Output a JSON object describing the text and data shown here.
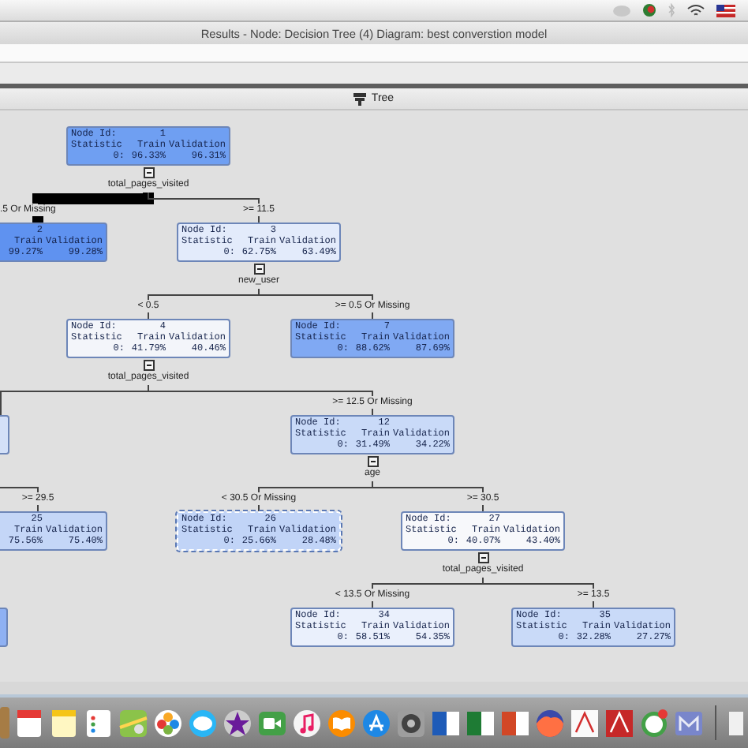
{
  "window": {
    "title": "Results - Node: Decision Tree (4)  Diagram: best converstion model"
  },
  "panel": {
    "title": "Tree"
  },
  "tree": {
    "nodes": [
      {
        "kind": "full",
        "id_label": "Node Id:",
        "id": "1",
        "header": [
          "Statistic",
          "Train",
          "Validation"
        ],
        "row": [
          "0:",
          "96.33%",
          "96.31%"
        ],
        "color": "#6f9ff2",
        "selected": false
      },
      {
        "kind": "cut",
        "id": "2",
        "header": [
          "Train",
          "Validation"
        ],
        "row": [
          "99.27%",
          "99.28%"
        ],
        "color": "#5f92f0",
        "selected": false
      },
      {
        "kind": "full",
        "id_label": "Node Id:",
        "id": "3",
        "header": [
          "Statistic",
          "Train",
          "Validation"
        ],
        "row": [
          "0:",
          "62.75%",
          "63.49%"
        ],
        "color": "#e3ebfb",
        "selected": false
      },
      {
        "kind": "full",
        "id_label": "Node Id:",
        "id": "4",
        "header": [
          "Statistic",
          "Train",
          "Validation"
        ],
        "row": [
          "0:",
          "41.79%",
          "40.46%"
        ],
        "color": "#f3f5fa",
        "selected": false
      },
      {
        "kind": "full",
        "id_label": "Node Id:",
        "id": "7",
        "header": [
          "Statistic",
          "Train",
          "Validation"
        ],
        "row": [
          "0:",
          "88.62%",
          "87.69%"
        ],
        "color": "#80a9f3",
        "selected": false
      },
      {
        "kind": "sliver",
        "color": "#d3e0f8",
        "selected": false
      },
      {
        "kind": "full",
        "id_label": "Node Id:",
        "id": "12",
        "header": [
          "Statistic",
          "Train",
          "Validation"
        ],
        "row": [
          "0:",
          "31.49%",
          "34.22%"
        ],
        "color": "#c9daf8",
        "selected": false
      },
      {
        "kind": "cut",
        "id": "25",
        "header": [
          "Train",
          "Validation"
        ],
        "row": [
          "75.56%",
          "75.40%"
        ],
        "color": "#c4d6f7",
        "selected": false
      },
      {
        "kind": "full",
        "id_label": "Node Id:",
        "id": "26",
        "header": [
          "Statistic",
          "Train",
          "Validation"
        ],
        "row": [
          "0:",
          "25.66%",
          "28.48%"
        ],
        "color": "#c1d4f7",
        "selected": true
      },
      {
        "kind": "full",
        "id_label": "Node Id:",
        "id": "27",
        "header": [
          "Statistic",
          "Train",
          "Validation"
        ],
        "row": [
          "0:",
          "40.07%",
          "43.40%"
        ],
        "color": "#f7f8fb",
        "selected": false
      },
      {
        "kind": "sliver",
        "color": "#8fb1f3",
        "selected": false
      },
      {
        "kind": "full",
        "id_label": "Node Id:",
        "id": "34",
        "header": [
          "Statistic",
          "Train",
          "Validation"
        ],
        "row": [
          "0:",
          "58.51%",
          "54.35%"
        ],
        "color": "#eaf0fc",
        "selected": false
      },
      {
        "kind": "full",
        "id_label": "Node Id:",
        "id": "35",
        "header": [
          "Statistic",
          "Train",
          "Validation"
        ],
        "row": [
          "0:",
          "32.28%",
          "27.27%"
        ],
        "color": "#c9daf8",
        "selected": false
      }
    ],
    "toggles": [
      {
        "expanded": true
      },
      {
        "expanded": true
      },
      {
        "expanded": true
      },
      {
        "expanded": true
      },
      {
        "expanded": true
      }
    ],
    "split_labels": [
      "total_pages_visited",
      "new_user",
      "total_pages_visited",
      "age",
      "total_pages_visited"
    ],
    "branch_labels": [
      ".5 Or Missing",
      ">= 11.5",
      "< 0.5",
      ">= 0.5 Or Missing",
      ">= 12.5 Or Missing",
      ">= 29.5",
      "< 30.5 Or Missing",
      ">= 30.5",
      "< 13.5 Or Missing",
      ">= 13.5"
    ]
  }
}
